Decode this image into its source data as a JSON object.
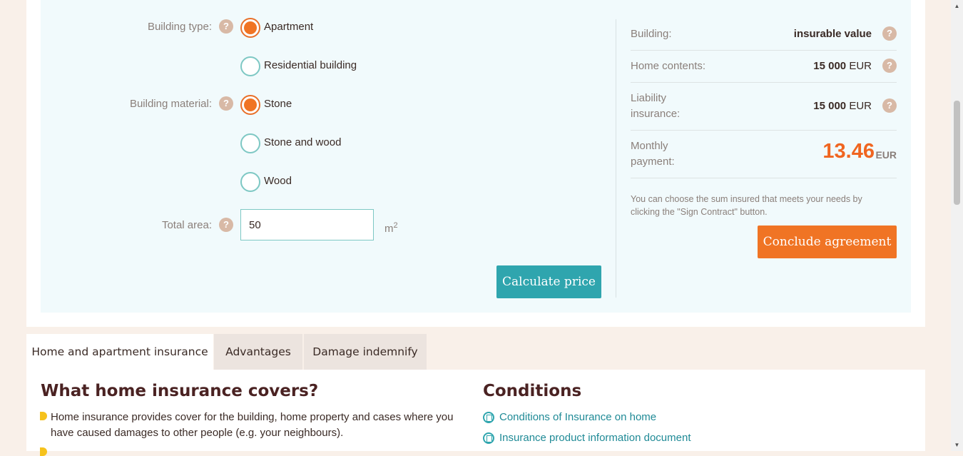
{
  "form": {
    "building_type": {
      "label": "Building type:",
      "options": [
        {
          "label": "Apartment",
          "checked": true
        },
        {
          "label": "Residential building",
          "checked": false
        }
      ]
    },
    "building_material": {
      "label": "Building material:",
      "options": [
        {
          "label": "Stone",
          "checked": true
        },
        {
          "label": "Stone and wood",
          "checked": false
        },
        {
          "label": "Wood",
          "checked": false
        }
      ]
    },
    "total_area": {
      "label": "Total area:",
      "value": "50",
      "unit": "m",
      "unit_sup": "2"
    },
    "calculate_label": "Calculate price"
  },
  "summary": {
    "building": {
      "label": "Building:",
      "value": "insurable value"
    },
    "contents": {
      "label": "Home contents:",
      "amount": "15 000",
      "currency": "EUR"
    },
    "liability": {
      "label_line1": "Liability",
      "label_line2": "insurance:",
      "amount": "15 000",
      "currency": "EUR"
    },
    "monthly": {
      "label_line1": "Monthly",
      "label_line2": "payment:",
      "amount": "13.46",
      "currency": "EUR"
    },
    "note": "You can choose the sum insured that meets your needs by clicking the \"Sign Contract\" button.",
    "conclude_label": "Conclude agreement"
  },
  "tabs": [
    {
      "label": "Home and apartment insurance",
      "active": true
    },
    {
      "label": "Advantages",
      "active": false
    },
    {
      "label": "Damage indemnify",
      "active": false
    }
  ],
  "covers": {
    "title": "What home insurance covers?",
    "bullets": [
      "Home insurance provides cover for the building, home property and cases where you have caused damages to other people (e.g. your neighbours)."
    ]
  },
  "conditions": {
    "title": "Conditions",
    "links": [
      "Conditions of Insurance on home",
      "Insurance product information document"
    ]
  },
  "colors": {
    "accent_orange": "#f07424",
    "accent_teal": "#2fa5ae",
    "panel_bg": "#f1fafc",
    "page_bg": "#f9f0e9"
  }
}
